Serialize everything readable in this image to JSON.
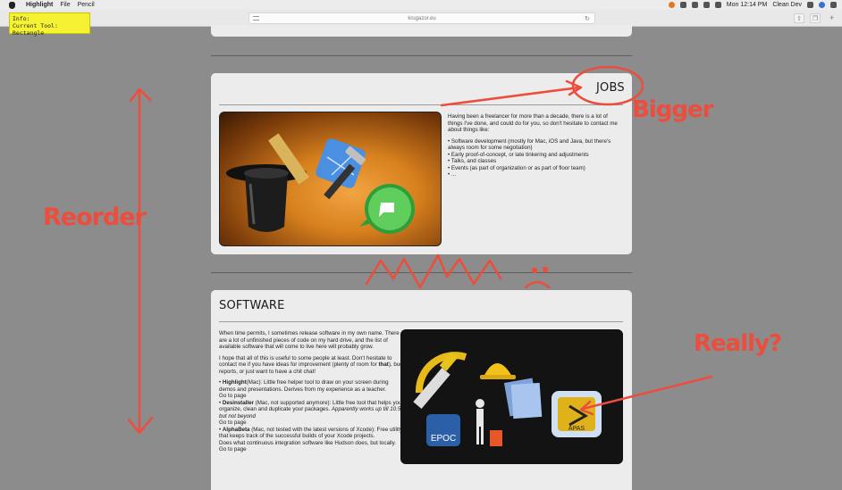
{
  "menubar": {
    "app_name": "Highlight",
    "menus": [
      "File",
      "Pencil"
    ],
    "clock": "Mon 12:14 PM",
    "user": "Clean Dev"
  },
  "browser": {
    "url": "krugazor.eu"
  },
  "info_note": {
    "line1": "Info:",
    "line2": "Current Tool: Rectangle"
  },
  "jobs": {
    "title": "JOBS",
    "intro": "Having been a freelancer for more than a decade, there is a lot of things I've done, and could do for you, so don't hesitate to contact me about things like:",
    "items": [
      "Software development (mostly for Mac, iOS and Java, but there's always room for some negotiation)",
      "Early proof-of-concept, or late tinkering and adjustments",
      "Talks, and classes",
      "Events (as part of organization or as part of floor team)",
      "..."
    ]
  },
  "software": {
    "title": "SOFTWARE",
    "para1": "When time permits, I sometimes release software in my own name. There are a lot of unfinished pieces of code on my hard drive, and the list of available software that will come to live here will probably grow.",
    "para2_a": "I hope that all of this is useful to some people at least. Don't hesitate to contact me if you have ideas for improvement (plenty of room for ",
    "para2_b": "that",
    "para2_c": "), bug reports, or just want to have a chit chat!",
    "items": [
      {
        "name": "Highlight",
        "desc": "(Mac): Little free helper tool to draw on your screen during demos and presentations. Derives from my experience as a teacher.",
        "link": "Go to page",
        "extra": ""
      },
      {
        "name": "Desinstaller",
        "desc": " (Mac, not supported anymore): Little free tool that helps you organize, clean and duplicate your packages. ",
        "italic": "Apparently works up till 10.5, but not beyond",
        "link": "Go to page",
        "extra": ""
      },
      {
        "name": "AlphaBeta",
        "desc": " (Mac, not tested with the latest versions of Xcode): Free utility that keeps track of the successful builds of your Xcode projects.",
        "extra": "Does what continuous integration software like Hudson does, but locally.",
        "link": "Go to page"
      }
    ],
    "icons": {
      "epoc": "EPOC",
      "apas": "APAS"
    }
  },
  "annotations": {
    "bigger": "Bigger",
    "reorder": "Reorder",
    "really": "Really?"
  },
  "colors": {
    "annotation": "#ec4d3c",
    "note": "#f4f232",
    "page_bg": "#8c8c8c",
    "card_bg": "#ececec"
  }
}
